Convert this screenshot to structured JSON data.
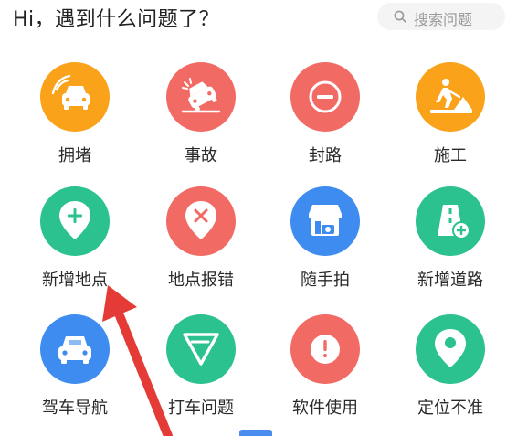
{
  "header": {
    "title": "Hi，遇到什么问题了？",
    "search_placeholder": "搜索问题"
  },
  "items": [
    {
      "label": "拥堵",
      "icon": "traffic-jam-icon",
      "color": "#f9a21a"
    },
    {
      "label": "事故",
      "icon": "accident-icon",
      "color": "#f26a64"
    },
    {
      "label": "封路",
      "icon": "road-closed-icon",
      "color": "#f26a64"
    },
    {
      "label": "施工",
      "icon": "construction-icon",
      "color": "#f9a21a"
    },
    {
      "label": "新增地点",
      "icon": "add-location-icon",
      "color": "#2bc28f"
    },
    {
      "label": "地点报错",
      "icon": "location-error-icon",
      "color": "#f26a64"
    },
    {
      "label": "随手拍",
      "icon": "camera-shop-icon",
      "color": "#3f8cf0"
    },
    {
      "label": "新增道路",
      "icon": "add-road-icon",
      "color": "#2bc28f"
    },
    {
      "label": "驾车导航",
      "icon": "car-navigation-icon",
      "color": "#3f8cf0"
    },
    {
      "label": "打车问题",
      "icon": "taxi-icon",
      "color": "#2bc28f"
    },
    {
      "label": "软件使用",
      "icon": "exclamation-icon",
      "color": "#f26a64"
    },
    {
      "label": "定位不准",
      "icon": "location-pin-icon",
      "color": "#2bc28f"
    }
  ]
}
